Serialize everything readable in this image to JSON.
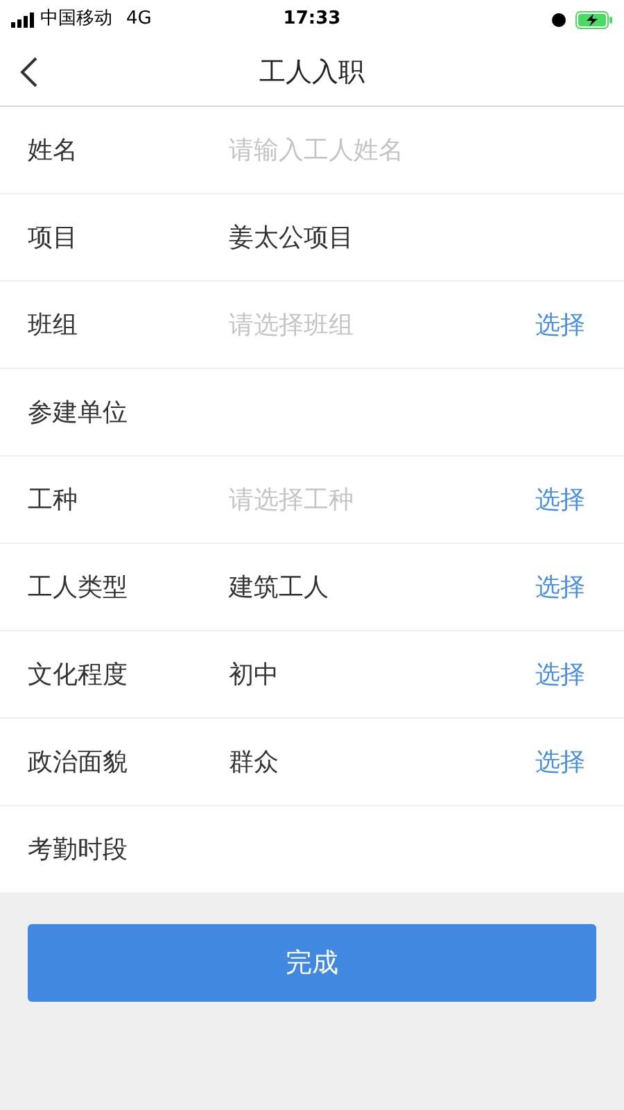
{
  "status_bar": {
    "carrier": "中国移动",
    "network": "4G",
    "time": "17:33"
  },
  "nav": {
    "title": "工人入职"
  },
  "fields": [
    {
      "label": "姓名",
      "placeholder": "请输入工人姓名"
    },
    {
      "label": "项目",
      "value": "姜太公项目"
    },
    {
      "label": "班组",
      "placeholder": "请选择班组",
      "action": "选择"
    },
    {
      "label": "参建单位"
    },
    {
      "label": "工种",
      "placeholder": "请选择工种",
      "action": "选择"
    },
    {
      "label": "工人类型",
      "value": "建筑工人",
      "action": "选择"
    },
    {
      "label": "文化程度",
      "value": "初中",
      "action": "选择"
    },
    {
      "label": "政治面貌",
      "value": "群众",
      "action": "选择"
    },
    {
      "label": "考勤时段"
    }
  ],
  "submit_button": "完成"
}
